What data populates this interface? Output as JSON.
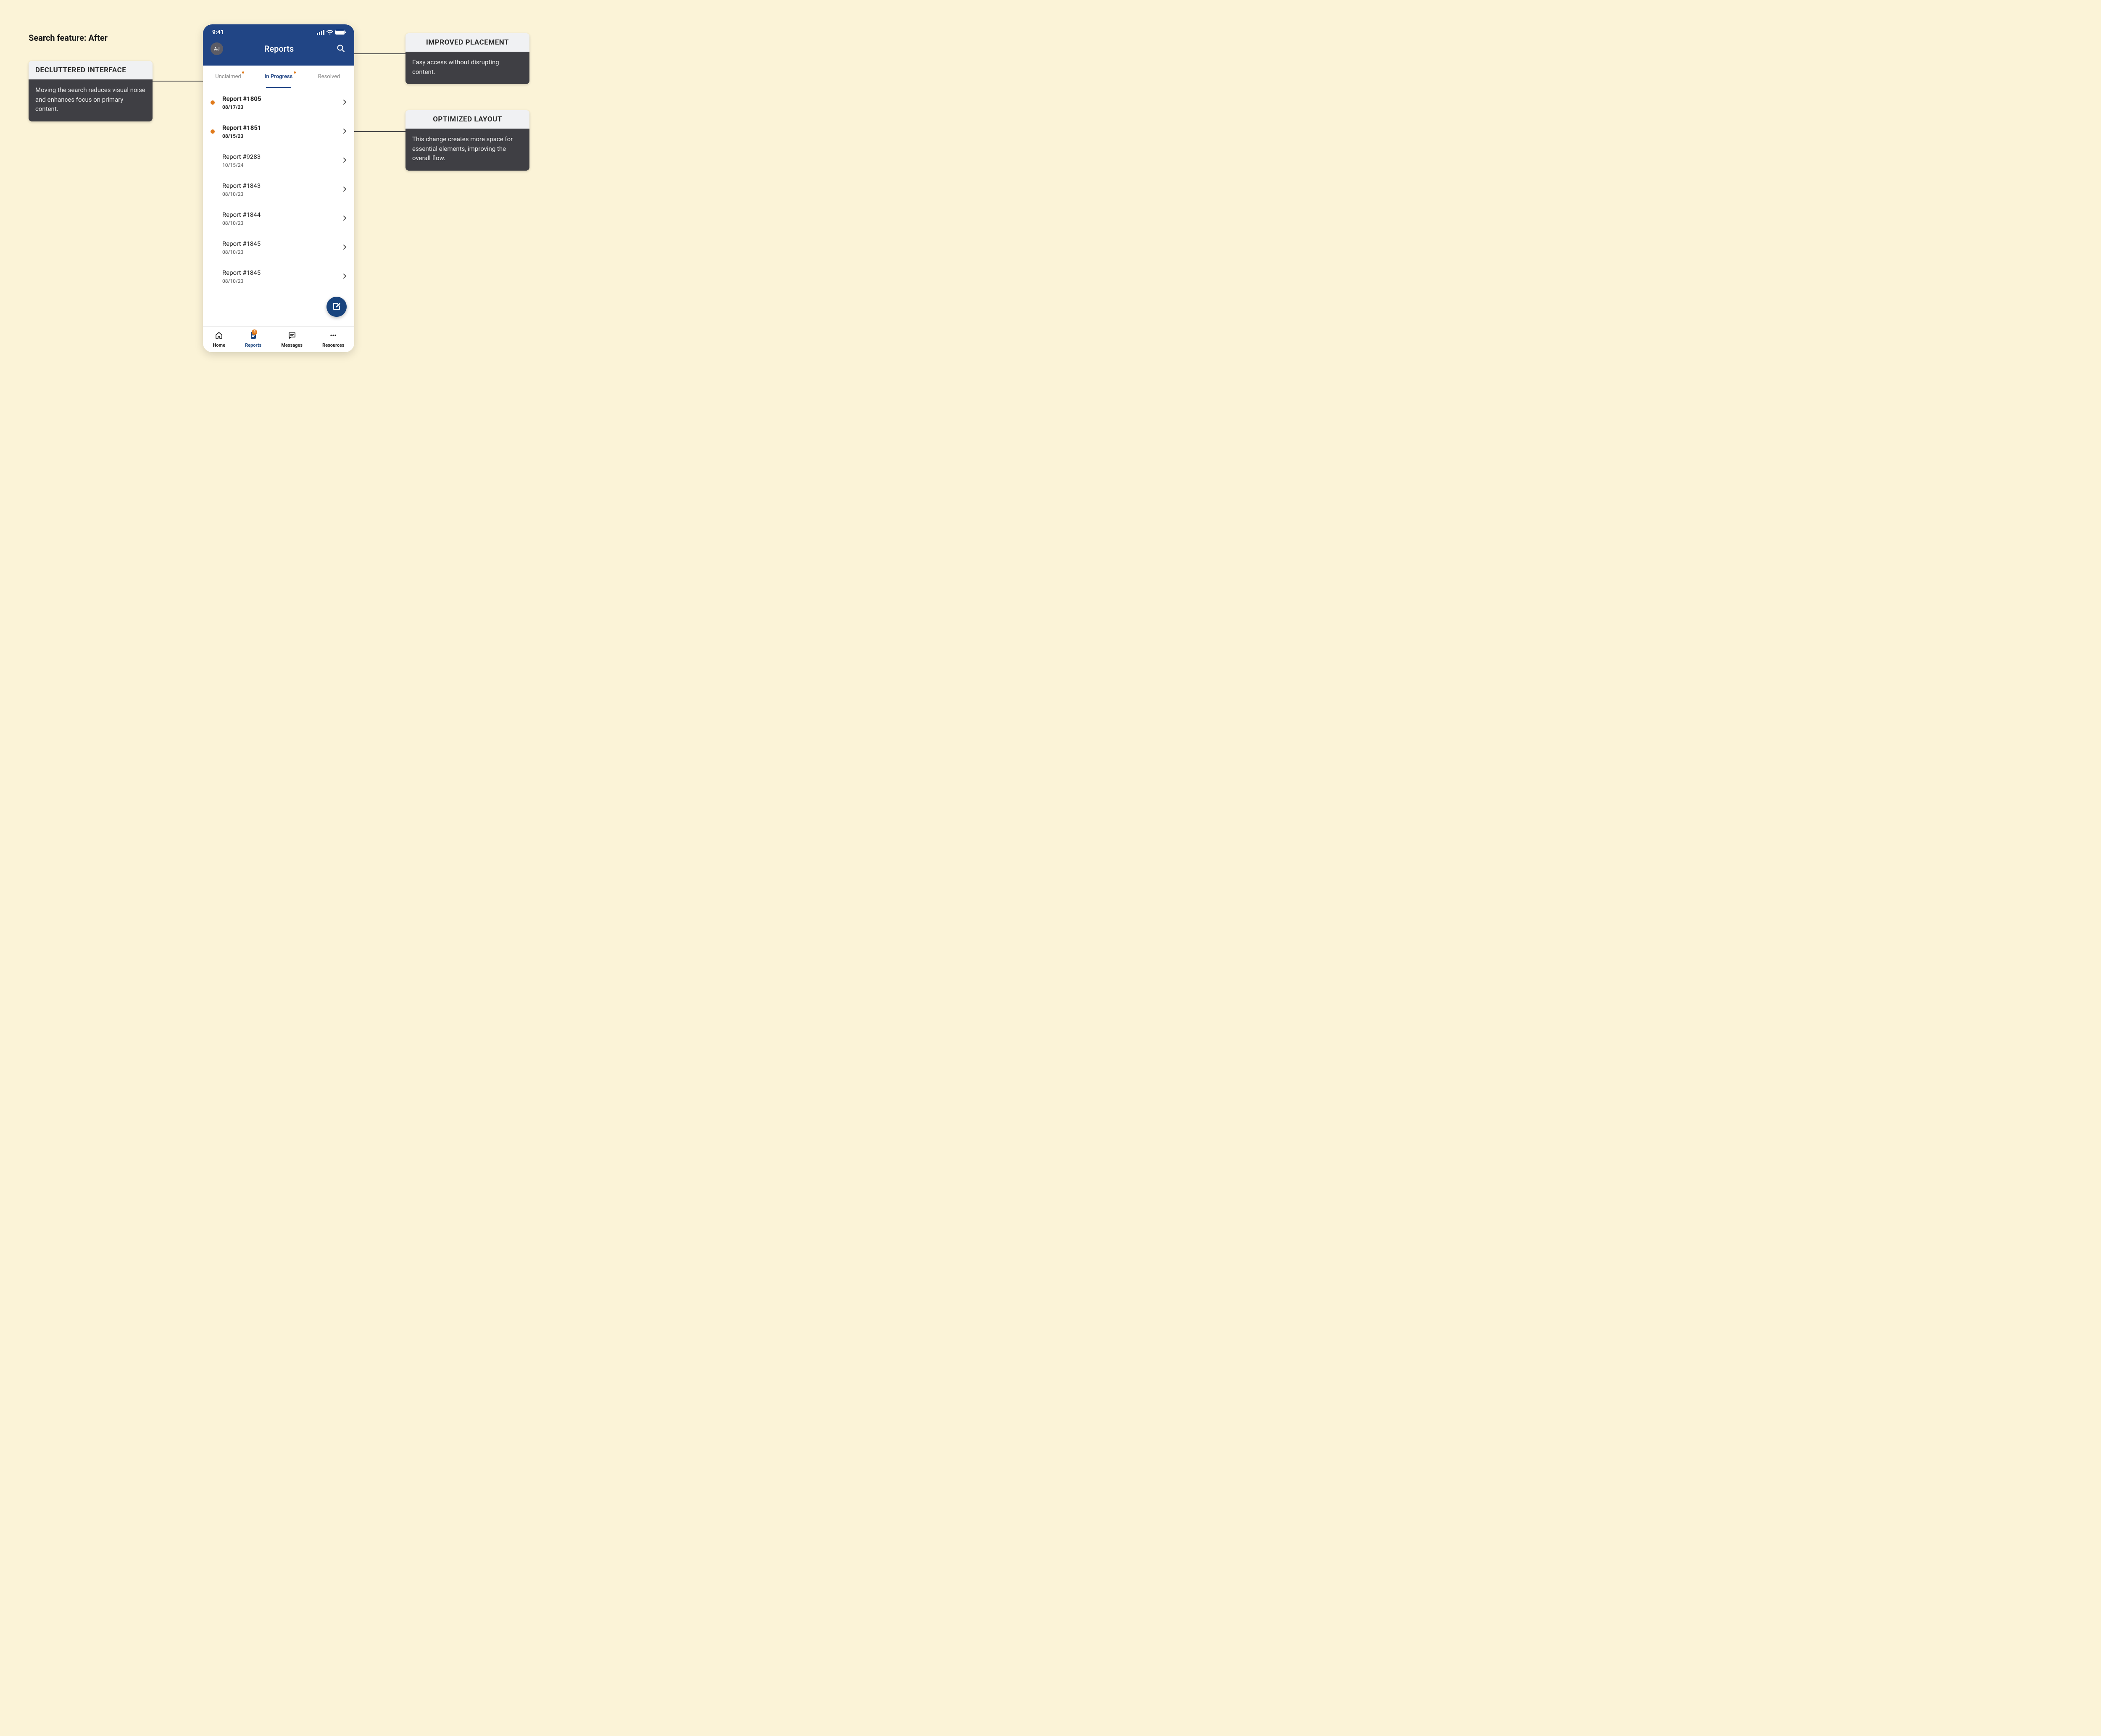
{
  "page_heading": "Search feature: After",
  "callouts": {
    "declutter": {
      "title": "DECLUTTERED INTERFACE",
      "body": "Moving the search reduces visual noise and enhances focus on primary content."
    },
    "placement": {
      "title": "IMPROVED PLACEMENT",
      "body": "Easy access without disrupting content."
    },
    "layout": {
      "title": "OPTIMIZED LAYOUT",
      "body": "This change creates more space for essential elements, improving the overall flow."
    }
  },
  "status": {
    "time": "9:41"
  },
  "header": {
    "avatar": "AJ",
    "title": "Reports"
  },
  "tabs": {
    "unclaimed": "Unclaimed",
    "inprogress": "In Progress",
    "resolved": "Resolved"
  },
  "reports": [
    {
      "title": "Report #1805",
      "date": "08/17/23",
      "unread": true
    },
    {
      "title": "Report #1851",
      "date": "08/15/23",
      "unread": true
    },
    {
      "title": "Report #9283",
      "date": "10/15/24",
      "unread": false
    },
    {
      "title": "Report #1843",
      "date": "08/10/23",
      "unread": false
    },
    {
      "title": "Report #1844",
      "date": "08/10/23",
      "unread": false
    },
    {
      "title": "Report #1845",
      "date": "08/10/23",
      "unread": false
    },
    {
      "title": "Report #1845",
      "date": "08/10/23",
      "unread": false
    }
  ],
  "nav": {
    "home": "Home",
    "reports": "Reports",
    "messages": "Messages",
    "resources": "Resources",
    "badge_count": "4"
  }
}
